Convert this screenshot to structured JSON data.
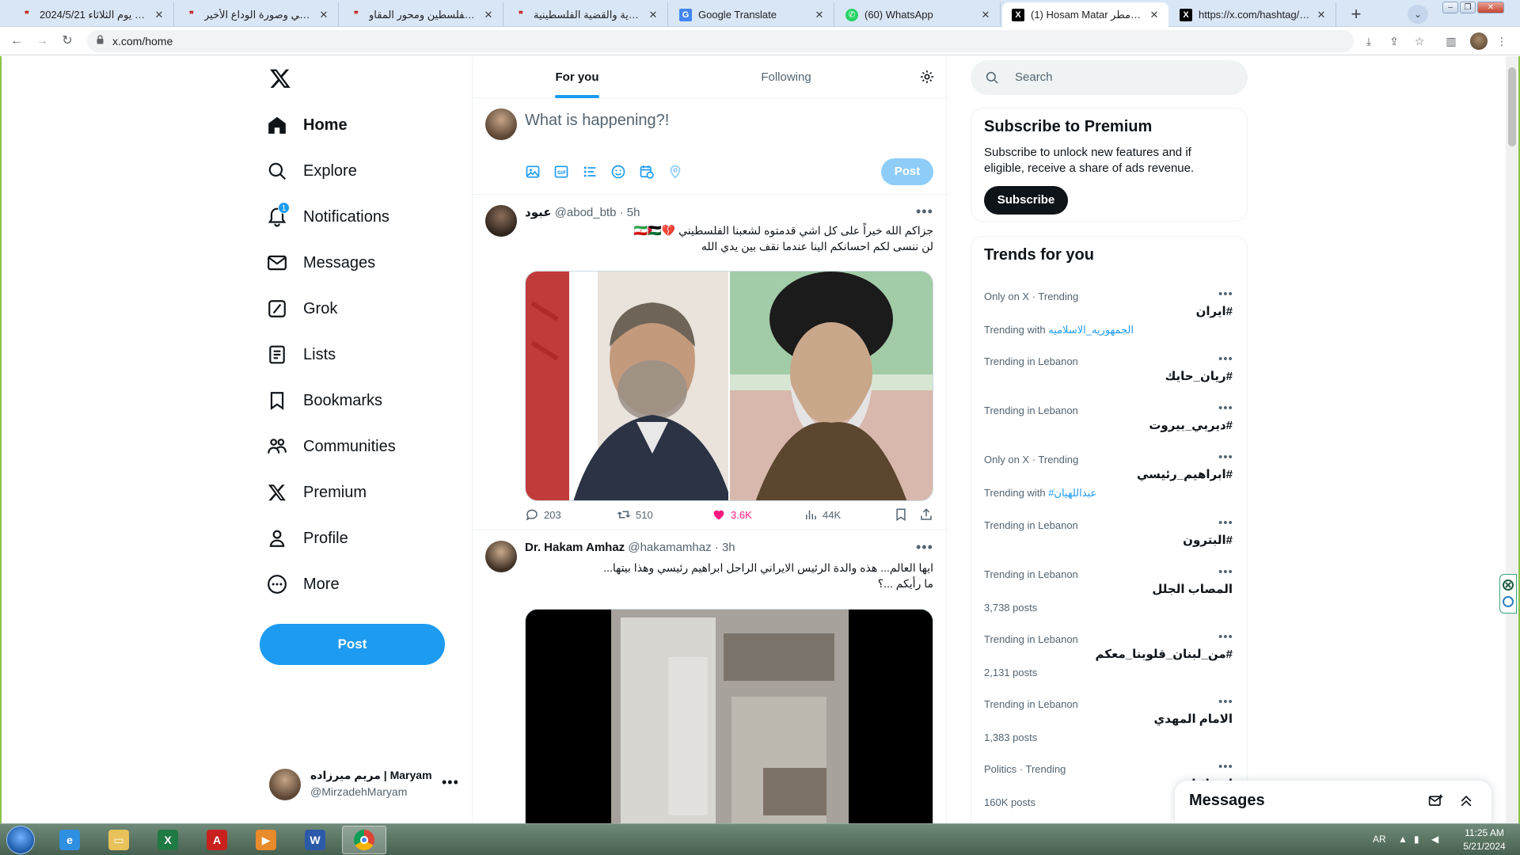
{
  "browser": {
    "tabs": [
      {
        "title": "عيد يوم الثلاثاء 2024/5/21",
        "icon": "quote-icon"
      },
      {
        "title": "رئيسي وصورة الوداع الأخير",
        "icon": "quote-icon"
      },
      {
        "title": "خسارة فادحة لفلسطين ومحور المقاو",
        "icon": "quote-icon"
      },
      {
        "title": "التسوية والقضية الفلسطينية",
        "icon": "quote-icon"
      },
      {
        "title": "Google Translate",
        "icon": "google-translate-icon"
      },
      {
        "title": "(60) WhatsApp",
        "icon": "whatsapp-icon"
      },
      {
        "title": "(1) Hosam Matar حسام مطر (@",
        "icon": "x-icon"
      },
      {
        "title": "https://x.com/hashtag/حسام مطر",
        "icon": "x-icon"
      }
    ],
    "url": "x.com/home"
  },
  "sidebar": {
    "items": [
      {
        "label": "Home",
        "icon": "home-icon"
      },
      {
        "label": "Explore",
        "icon": "search-icon"
      },
      {
        "label": "Notifications",
        "icon": "bell-icon",
        "badge": "1"
      },
      {
        "label": "Messages",
        "icon": "envelope-icon"
      },
      {
        "label": "Grok",
        "icon": "grok-icon"
      },
      {
        "label": "Lists",
        "icon": "list-icon"
      },
      {
        "label": "Bookmarks",
        "icon": "bookmark-icon"
      },
      {
        "label": "Communities",
        "icon": "communities-icon"
      },
      {
        "label": "Premium",
        "icon": "x-icon"
      },
      {
        "label": "Profile",
        "icon": "profile-icon"
      },
      {
        "label": "More",
        "icon": "more-circle-icon"
      }
    ],
    "post_label": "Post",
    "account": {
      "name": "مریم میرزاده | Maryam M",
      "handle": "@MirzadehMaryam"
    }
  },
  "feed": {
    "tabs": [
      "For you",
      "Following"
    ],
    "composer": {
      "placeholder": "What is happening?!",
      "post_label": "Post"
    },
    "tweets": [
      {
        "name": "عبود",
        "handle": "@abod_btb",
        "time": "5h",
        "text": [
          "جزاكم الله خيراً على كل اشي قدمتوه لشعبنا الفلسطيني 💔🇮🇷🇵🇸",
          "لن ننسى لكم احسانكم الينا عندما نقف بين يدي الله"
        ],
        "replies": "203",
        "reposts": "510",
        "likes": "3.6K",
        "views": "44K"
      },
      {
        "name": "Dr. Hakam Amhaz",
        "handle": "@hakamamhaz",
        "time": "3h",
        "text": [
          "ايها العالم... هذه والدة الرئيس الايراني الراحل ابراهيم رئيسي وهذا بيتها...",
          "ما رأيكم ...؟"
        ]
      }
    ]
  },
  "right": {
    "search_placeholder": "Search",
    "premium": {
      "title": "Subscribe to Premium",
      "desc": "Subscribe to unlock new features and if eligible, receive a share of ads revenue.",
      "button": "Subscribe"
    },
    "trends_title": "Trends for you",
    "trends": [
      {
        "meta": "Only on X · Trending",
        "name": "#ايران",
        "with_label": "Trending with",
        "with": "الجمهوريه_الاسلاميه"
      },
      {
        "meta": "Trending in Lebanon",
        "name": "#ريان_حايك"
      },
      {
        "meta": "Trending in Lebanon",
        "name": "#ديربي_بيروت"
      },
      {
        "meta": "Only on X · Trending",
        "name": "#ابراهيم_رئيسي",
        "with_label": "Trending with",
        "with": "#عبداللهيان"
      },
      {
        "meta": "Trending in Lebanon",
        "name": "#البترون"
      },
      {
        "meta": "Trending in Lebanon",
        "name": "المصاب الجلل",
        "posts": "3,738 posts"
      },
      {
        "meta": "Trending in Lebanon",
        "name": "#من_لبنان_قلوبنا_معكم",
        "posts": "2,131 posts"
      },
      {
        "meta": "Trending in Lebanon",
        "name": "الامام المهدي",
        "posts": "1,383 posts"
      },
      {
        "meta": "Politics · Trending",
        "name": "اسرائيل",
        "posts": "160K posts"
      }
    ],
    "messages_label": "Messages"
  },
  "taskbar": {
    "lang": "AR",
    "time": "11:25 AM",
    "date": "5/21/2024"
  },
  "colors": {
    "accent": "#1d9bf0",
    "like": "#f91880"
  }
}
